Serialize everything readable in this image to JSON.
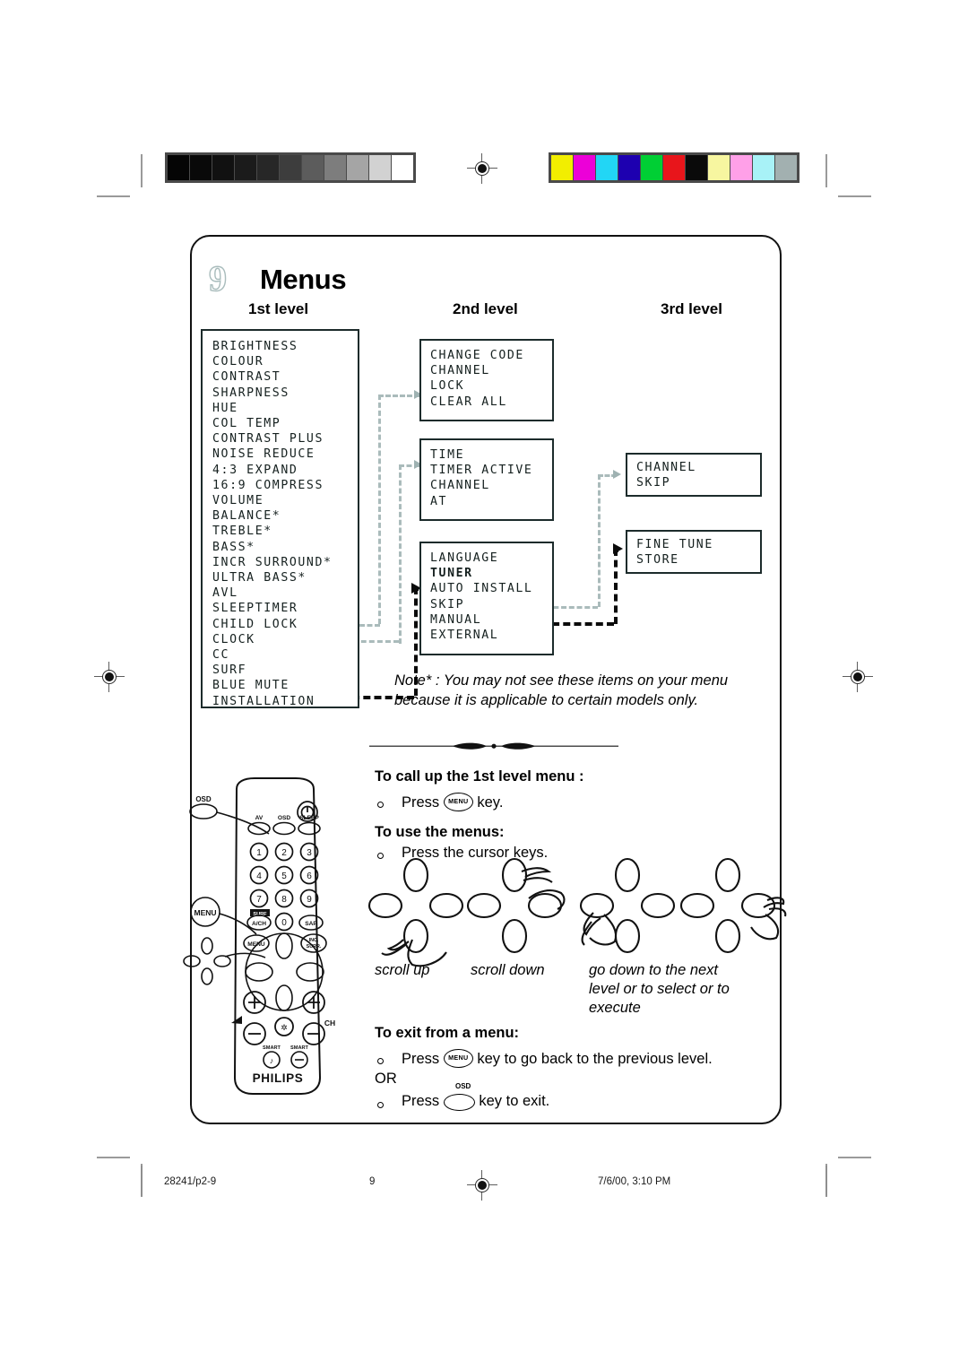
{
  "document": {
    "chapter_number": "9",
    "chapter_title": "Menus"
  },
  "columns": {
    "first": "1st level",
    "second": "2nd level",
    "third": "3rd level"
  },
  "menus": {
    "level1": {
      "items": [
        "BRIGHTNESS",
        "COLOUR",
        "CONTRAST",
        "SHARPNESS",
        "HUE",
        "COL TEMP",
        "CONTRAST PLUS",
        "NOISE REDUCE",
        "4:3 EXPAND",
        "16:9 COMPRESS",
        "VOLUME",
        "BALANCE*",
        "TREBLE*",
        "BASS*",
        "INCR SURROUND*",
        "ULTRA BASS*",
        "AVL",
        "SLEEPTIMER",
        "CHILD LOCK",
        "CLOCK",
        "CC",
        "SURF",
        "BLUE MUTE",
        "INSTALLATION"
      ]
    },
    "level2_childlock": {
      "items": [
        "CHANGE CODE",
        "CHANNEL",
        "LOCK",
        "CLEAR ALL"
      ]
    },
    "level2_clock": {
      "items": [
        "TIME",
        "TIMER ACTIVE",
        "CHANNEL",
        "AT"
      ]
    },
    "level2_installation": {
      "items": [
        "LANGUAGE",
        "TUNER",
        "AUTO INSTALL",
        "SKIP",
        "MANUAL",
        "EXTERNAL"
      ]
    },
    "level3_skip": {
      "items": [
        "CHANNEL",
        "SKIP"
      ]
    },
    "level3_manual": {
      "items": [
        "FINE TUNE",
        "STORE"
      ]
    }
  },
  "note": {
    "text": "Note* : You may not see these items on your menu because it is applicable to certain models only."
  },
  "instructions": {
    "callup_heading": "To call up the 1st level menu :",
    "callup_step_pre": "Press",
    "callup_step_post": "key.",
    "use_heading": "To use the menus:",
    "use_step": "Press the cursor keys.",
    "exit_heading": "To exit from a menu:",
    "exit_step1_pre": "Press",
    "exit_step1_post": "key to go back to the previous level.",
    "exit_or": "OR",
    "exit_step2_pre": "Press",
    "exit_step2_post": "key to exit.",
    "menu_key_label": "MENU",
    "osd_key_label": "OSD"
  },
  "cursor_captions": [
    "scroll up",
    "scroll down",
    "go down to the next level or to select or to execute"
  ],
  "remote": {
    "brand": "PHILIPS",
    "callout_osd": "OSD",
    "callout_menu": "MENU",
    "buttons": {
      "av": "AV",
      "osd": "OSD",
      "sleep": "SLEEP",
      "numbers": [
        "1",
        "2",
        "3",
        "4",
        "5",
        "6",
        "7",
        "8",
        "9",
        "0"
      ],
      "surf": "SURF",
      "av_ch": "A/CH",
      "sap": "SAP",
      "menu": "MENU",
      "inc_surr": "INC. SURR.",
      "ch": "CH",
      "smart_sound": "SMART",
      "smart_picture": "SMART"
    }
  },
  "footer": {
    "left": "28241/p2-9",
    "page": "9",
    "right": "7/6/00, 3:10 PM"
  },
  "calibration": {
    "gray_bar": [
      "#050505",
      "#090909",
      "#111111",
      "#1b1b1b",
      "#272727",
      "#3d3d3d",
      "#5c5c5c",
      "#7d7d7d",
      "#a5a5a5",
      "#d2d2d2",
      "#ffffff"
    ],
    "color_bar": [
      "#f2ee00",
      "#ec00d8",
      "#22d6f5",
      "#1d00b0",
      "#00cf34",
      "#e8151b",
      "#0a0a0a",
      "#f7f6a0",
      "#ffa0e8",
      "#a8f2f7",
      "#a2b0b0"
    ]
  },
  "colors": {
    "dash_light": "#aabbbb",
    "dash_dark": "#0b0b0b",
    "box_border": "#1c2b2b",
    "chapter_numeral": "#a9bcbc"
  }
}
